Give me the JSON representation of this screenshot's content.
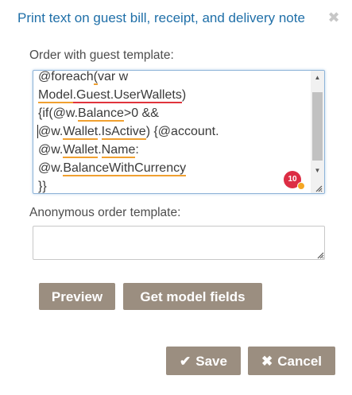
{
  "dialog": {
    "title": "Print text on guest bill, receipt, and delivery note",
    "close_glyph": "✖"
  },
  "order_template": {
    "label": "Order with guest template:",
    "badge_count": "10",
    "code": {
      "l1a": "@foreach",
      "l1b": "(",
      "l1c": "var w",
      "l2a": "Model",
      "l2b": ".",
      "l2c": "Guest",
      "l2d": ".",
      "l2e": "UserWallets",
      "l2f": ")",
      "l3a": "{if(@w.",
      "l3b": "Balance",
      "l3c": ">0 &&",
      "l4a": "@w.",
      "l4b": "Wallet",
      "l4c": ".",
      "l4d": "IsActive",
      "l4e": ") {@account.",
      "l5a": "@w.",
      "l5b": "Wallet",
      "l5c": ".",
      "l5d": "Name",
      "l5e": ":",
      "l6a": "@w.",
      "l6b": "BalanceWithCurrency",
      "l7a": "}}"
    }
  },
  "anonymous_template": {
    "label": "Anonymous order template:",
    "value": ""
  },
  "buttons": {
    "preview": "Preview",
    "get_model_fields": "Get model fields",
    "save": "Save",
    "cancel": "Cancel",
    "save_icon": "✔",
    "cancel_icon": "✖"
  },
  "colors": {
    "title": "#1f6fa8",
    "button_bg": "#9b8e80",
    "underline_warning": "#f0a030",
    "underline_error": "#e0343c",
    "badge": "#dc2d44"
  },
  "icons": {
    "close": "close-icon",
    "save": "check-icon",
    "cancel": "x-icon",
    "resize": "resize-grip-icon"
  }
}
